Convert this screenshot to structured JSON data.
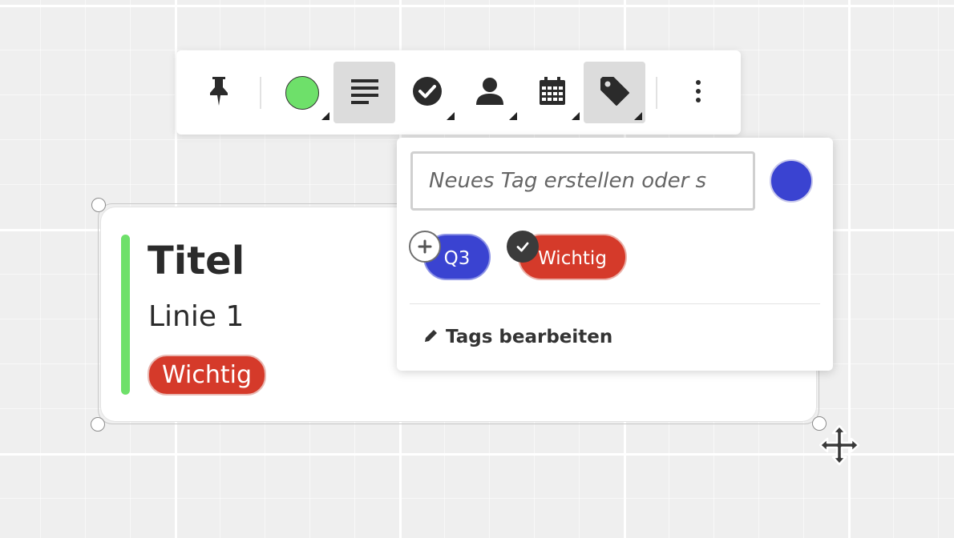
{
  "toolbar": {
    "buttons": [
      {
        "name": "pin",
        "icon": "pin-icon"
      },
      {
        "name": "color",
        "icon": "color-swatch",
        "color": "#6ee06a"
      },
      {
        "name": "text-align",
        "icon": "text-lines-icon",
        "active": true
      },
      {
        "name": "checklist",
        "icon": "check-circle-icon"
      },
      {
        "name": "assignee",
        "icon": "person-icon"
      },
      {
        "name": "date",
        "icon": "calendar-icon"
      },
      {
        "name": "tags",
        "icon": "tag-icon",
        "active": true
      },
      {
        "name": "more",
        "icon": "more-vertical-icon"
      }
    ]
  },
  "card": {
    "title": "Titel",
    "line1": "Linie 1",
    "tag": "Wichtig",
    "accent_color": "#6ee06a"
  },
  "tag_popover": {
    "input_placeholder": "Neues Tag erstellen oder s",
    "new_tag_color": "#3a43d1",
    "tags": [
      {
        "label": "Q3",
        "color": "#3a43d1",
        "selected": false
      },
      {
        "label": "Wichtig",
        "color": "#d53a2a",
        "selected": true
      }
    ],
    "edit_label": "Tags bearbeiten"
  }
}
